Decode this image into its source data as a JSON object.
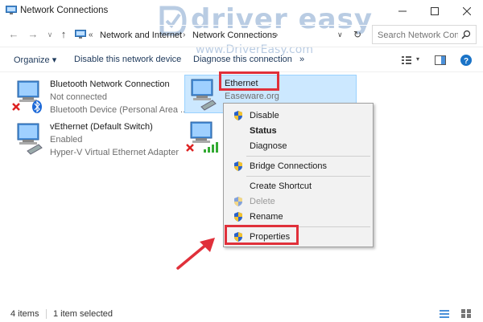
{
  "window": {
    "title": "Network Connections"
  },
  "address": {
    "crumbs": [
      "Network and Internet",
      "Network Connections"
    ],
    "overflow": "«",
    "more": "»",
    "search_placeholder": "Search Network Con..."
  },
  "watermark": {
    "brand": "driver easy",
    "url": "www.DriverEasy.com"
  },
  "toolbar": {
    "organize": "Organize ▾",
    "disable": "Disable this network device",
    "diagnose": "Diagnose this connection",
    "more": "»"
  },
  "connections": [
    {
      "name": "Bluetooth Network Connection",
      "status": "Not connected",
      "device": "Bluetooth Device (Personal Area ...",
      "icon": "bluetooth-network-icon"
    },
    {
      "name": "Ethernet",
      "status": "Easeware.org",
      "device": "",
      "icon": "ethernet-icon"
    },
    {
      "name": "vEthernet (Default Switch)",
      "status": "Enabled",
      "device": "Hyper-V Virtual Ethernet Adapter",
      "icon": "vethernet-icon"
    },
    {
      "name": "",
      "status": "",
      "device": "",
      "icon": "wifi-adapter-icon"
    }
  ],
  "context_menu": {
    "items": [
      {
        "label": "Disable",
        "shield": true,
        "bold": false,
        "disabled": false
      },
      {
        "label": "Status",
        "shield": false,
        "bold": true,
        "disabled": false
      },
      {
        "label": "Diagnose",
        "shield": false,
        "bold": false,
        "disabled": false
      },
      {
        "label": "Bridge Connections",
        "shield": true,
        "bold": false,
        "disabled": false
      },
      {
        "label": "Create Shortcut",
        "shield": false,
        "bold": false,
        "disabled": false
      },
      {
        "label": "Delete",
        "shield": true,
        "bold": false,
        "disabled": true
      },
      {
        "label": "Rename",
        "shield": true,
        "bold": false,
        "disabled": false
      },
      {
        "label": "Properties",
        "shield": true,
        "bold": false,
        "disabled": false
      }
    ]
  },
  "statusbar": {
    "count": "4 items",
    "selected": "1 item selected"
  },
  "colors": {
    "accent_red": "#e0303a",
    "selection": "#cce8ff",
    "link_blue": "#1e395b"
  }
}
